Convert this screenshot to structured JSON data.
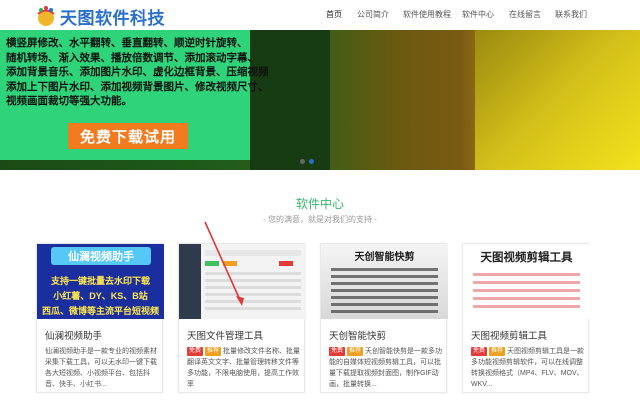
{
  "brand": {
    "name": "天图软件科技"
  },
  "nav": {
    "items": [
      {
        "label": "首页",
        "active": true
      },
      {
        "label": "公司简介",
        "active": false
      },
      {
        "label": "软件使用教程",
        "active": false
      },
      {
        "label": "软件中心",
        "active": false
      },
      {
        "label": "在线留言",
        "active": false
      },
      {
        "label": "联系我们",
        "active": false
      }
    ]
  },
  "banner": {
    "lines": [
      "横竖屏修改、水平翻转、垂直翻转、顺逆时针旋转、",
      "随机转场、渐入效果、播放倍数调节、添加滚动字幕、",
      "添加背景音乐、添加图片水印、虚化边框背景、压缩视频",
      "添加上下图片水印、添加视频背景图片、修改视频尺寸、",
      "视频画面裁切等强大功能。"
    ],
    "cta_label": "免费下载试用",
    "colors": {
      "left_panel": "#2fd47a",
      "cta": "#f27a1f"
    }
  },
  "section": {
    "title": "软件中心",
    "subtitle": "- 您的满意，就是对我们的支持 -"
  },
  "cards": [
    {
      "thumb_title": "仙澜视频助手",
      "thumb_lines": [
        "支持一键批量去水印下载",
        "小红薯、DY、KS、B站",
        "西瓜、微博等主流平台短视频"
      ],
      "title": "仙澜视频助手",
      "desc": "仙澜视频助手是一款专业的视频素材采集下载工具，可以无水印一键下载各大短视频、小视频平台、包括抖音、快手、小红书..."
    },
    {
      "title": "天图文件管理工具",
      "tag_free": "免费",
      "tag_rec": "推荐",
      "desc": "批量修改文件名称、批量翻译英文文字、批量管理转移文件等多功能，不限电脑使用，提高工作效率"
    },
    {
      "thumb_title": "天创智能快剪",
      "title": "天创智能快剪",
      "tag_free": "免费",
      "tag_rec": "推荐",
      "desc": "天创智能快剪是一款多功能的自媒体短视频剪辑工具，可以批量下载提取视频封面图，制作GIF动画，批量转换..."
    },
    {
      "thumb_title": "天图视频剪辑工具",
      "title": "天图视频剪辑工具",
      "tag_free": "免费",
      "tag_rec": "推荐",
      "desc": "天图视频剪辑工具是一款多功能视频剪辑软件，可以在线调整转换视频格式（MP4、FLV、MOV、WKV..."
    }
  ]
}
